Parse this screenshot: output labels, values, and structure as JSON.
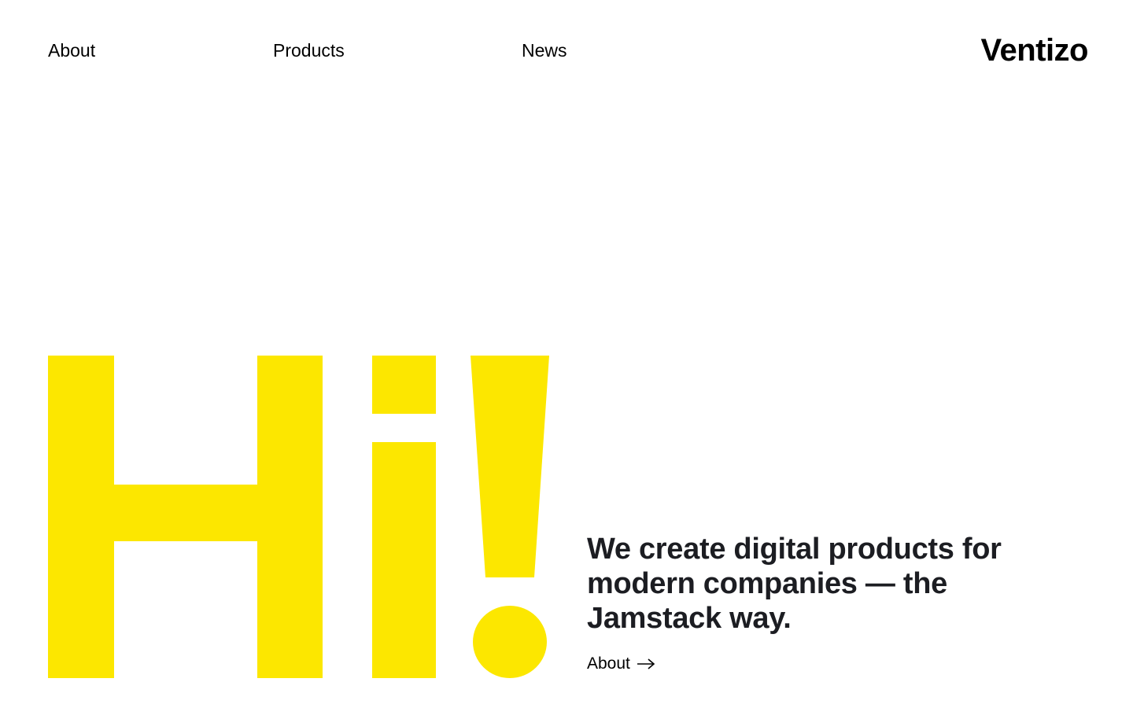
{
  "nav": {
    "items": [
      {
        "label": "About"
      },
      {
        "label": "Products"
      },
      {
        "label": "News"
      }
    ]
  },
  "brand": {
    "logo_text": "Ventizo"
  },
  "hero": {
    "graphic_text": "Hi!",
    "graphic_color": "#fce700",
    "tagline": "We create digital products for modern companies — the Jamstack way.",
    "cta_label": "About",
    "cta_icon": "arrow-right-icon"
  }
}
